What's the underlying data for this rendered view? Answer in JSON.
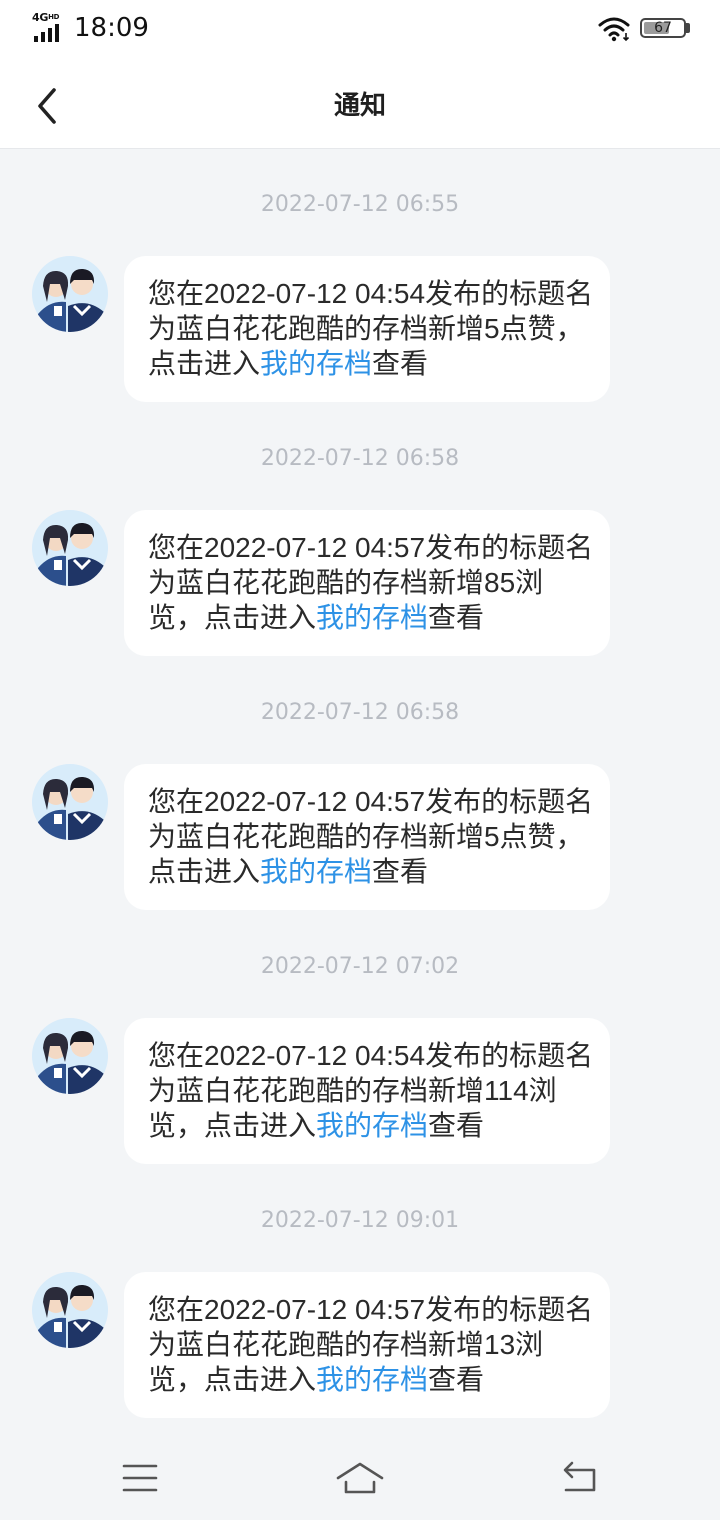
{
  "status_bar": {
    "network": "4G",
    "network_badge": "HD",
    "time": "18:09",
    "battery_level": "67",
    "battery_fraction": 0.67,
    "icons": [
      "signal-icon",
      "wifi-icon",
      "battery-icon"
    ]
  },
  "header": {
    "title": "通知",
    "back_icon": "back-chevron-icon"
  },
  "theme": {
    "page_bg": "#f3f5f7",
    "bubble_bg": "#ffffff",
    "link_color": "#2d92e6",
    "time_color": "#b7bbc2"
  },
  "notifications": [
    {
      "time": "2022-07-12 06:55",
      "text_before": "您在2022-07-12 04:54发布的标题名为蓝白花花跑酷的存档新增5点赞，点击进入",
      "link": "我的存档",
      "text_after": "查看"
    },
    {
      "time": "2022-07-12 06:58",
      "text_before": "您在2022-07-12 04:57发布的标题名为蓝白花花跑酷的存档新增85浏览，点击进入",
      "link": "我的存档",
      "text_after": "查看"
    },
    {
      "time": "2022-07-12 06:58",
      "text_before": "您在2022-07-12 04:57发布的标题名为蓝白花花跑酷的存档新增5点赞，点击进入",
      "link": "我的存档",
      "text_after": "查看"
    },
    {
      "time": "2022-07-12 07:02",
      "text_before": "您在2022-07-12 04:54发布的标题名为蓝白花花跑酷的存档新增114浏览，点击进入",
      "link": "我的存档",
      "text_after": "查看"
    },
    {
      "time": "2022-07-12 09:01",
      "text_before": "您在2022-07-12 04:57发布的标题名为蓝白花花跑酷的存档新增13浏览，点击进入",
      "link": "我的存档",
      "text_after": "查看"
    }
  ],
  "nav_bar": {
    "buttons": [
      "menu-icon",
      "home-icon",
      "return-icon"
    ]
  }
}
